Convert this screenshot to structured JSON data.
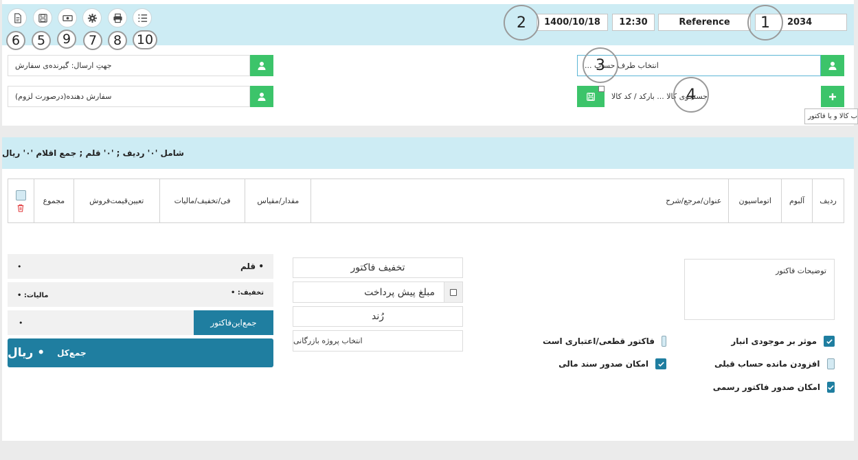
{
  "header": {
    "reference_number": "2034",
    "reference_label": "Reference",
    "time": "12:30",
    "date": "1400/10/18"
  },
  "toolbar": {
    "buttons": [
      {
        "icon": "document-icon"
      },
      {
        "icon": "save-icon"
      },
      {
        "icon": "cash-icon"
      },
      {
        "icon": "gear-icon"
      },
      {
        "icon": "print-icon"
      },
      {
        "icon": "list-icon"
      }
    ],
    "badges": [
      "6",
      "5",
      "9",
      "7",
      "8",
      "10"
    ]
  },
  "callouts": {
    "c1": "1",
    "c2": "2",
    "c3": "3",
    "c4": "4"
  },
  "fields": {
    "account_select": "انتخاب طرف حساب ...",
    "product_search": "جستجوی کالا ... بارکد / کد کالا",
    "tooltip": "ب کالا و یا فاکتور",
    "send_direction": "جهتِ ارسال: گیرنده‌ی سفارش",
    "order_giver": "سفارش دهنده(درصورت لزوم)"
  },
  "summary": {
    "text": "شامل '۰' ردیف ; '۰' قلم ; جمع اقلام '۰' ریال"
  },
  "table": {
    "columns": [
      "ردیف",
      "آلبوم",
      "اتوماسیون",
      "عنوان/مرجع/شرح",
      "مقدار/مقیاس",
      "فی/تخفیف/مالیات",
      "تعیین‌قیمت‌فروش",
      "مجموع"
    ]
  },
  "totals": {
    "qalam_label": "• قلم",
    "qalam_value": "•",
    "discount_label": "تخفیف: •",
    "tax_label": "مالیات: •",
    "invoice_sum_label": "جمع‌این‌فاکتور",
    "invoice_sum_value": "•",
    "grand_label": "جمع‌کل",
    "grand_value": "• ریال"
  },
  "middle": {
    "invoice_discount": "تخفیف فاکتور",
    "prepayment": "مبلغ پیش پرداخت",
    "round": "رُند",
    "project_select": "انتخاب پروژه بازرگانی"
  },
  "notes": {
    "label": "توضیحات فاکتور"
  },
  "checkboxes": {
    "inventory": {
      "label": "موثر بر موجودی انبار",
      "checked": true
    },
    "previous_balance": {
      "label": "افزودن مانده حساب قبلی",
      "checked": false
    },
    "official_invoice": {
      "label": "امکان صدور فاکتور رسمی",
      "checked": true
    },
    "final_invoice": {
      "label": "فاکتور قطعی/اعتباری است",
      "checked": false
    },
    "financial_doc": {
      "label": "امکان صدور سند مالی",
      "checked": true
    }
  },
  "colors": {
    "toolbar_bg": "#cdecf4",
    "accent_teal": "#1f7ea0",
    "green": "#3cc46a",
    "trash_red": "#e0383b"
  }
}
